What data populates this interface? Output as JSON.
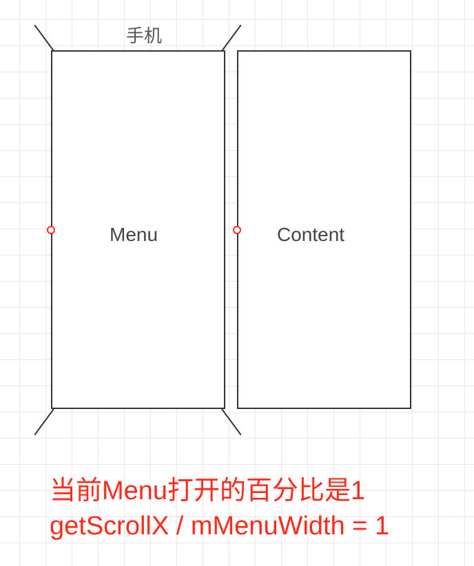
{
  "labels": {
    "phone": "手机",
    "menu": "Menu",
    "content": "Content"
  },
  "caption": {
    "line1": "当前Menu打开的百分比是1",
    "line2": "getScrollX / mMenuWidth = 1"
  }
}
